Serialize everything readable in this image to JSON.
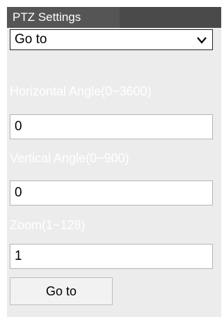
{
  "header": {
    "title": "PTZ Settings"
  },
  "mode_select": {
    "value": "Go to",
    "icon": "chevron-down-icon"
  },
  "fields": [
    {
      "label": "Horizontal Angle(0~3600)",
      "value": "0"
    },
    {
      "label": "Vertical Angle(0~900)",
      "value": "0"
    },
    {
      "label": "Zoom(1~128)",
      "value": "1"
    }
  ],
  "action": {
    "goto_label": "Go to"
  },
  "colors": {
    "header_bg": "#4a4a4a",
    "panel_bg": "#ececec",
    "label_text": "#ffffff"
  }
}
